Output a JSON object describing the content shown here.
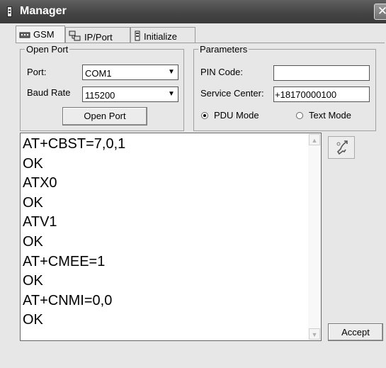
{
  "window": {
    "title": "Manager",
    "close_glyph": "✕"
  },
  "tabs": [
    {
      "label": "GSM",
      "icon": "modem-icon",
      "active": true
    },
    {
      "label": "IP/Port",
      "icon": "network-icon",
      "active": false
    },
    {
      "label": "Initialize",
      "icon": "device-icon",
      "active": false
    }
  ],
  "open_port": {
    "legend": "Open Port",
    "port_label": "Port:",
    "port_value": "COM1",
    "baud_label": "Baud Rate",
    "baud_value": "115200",
    "button_label": "Open Port"
  },
  "parameters": {
    "legend": "Parameters",
    "pin_label": "PIN Code:",
    "pin_value": "",
    "service_label": "Service Center:",
    "service_value": "+18170000100",
    "pdu_label": "PDU Mode",
    "text_label": "Text Mode",
    "mode_selected": "PDU Mode"
  },
  "console": {
    "lines": [
      "AT+CBST=7,0,1",
      "OK",
      "ATX0",
      "OK",
      "ATV1",
      "OK",
      "AT+CMEE=1",
      "OK",
      "AT+CNMI=0,0",
      "OK"
    ]
  },
  "side": {
    "accept_label": "Accept",
    "action_icon": "phone-hook-icon"
  }
}
